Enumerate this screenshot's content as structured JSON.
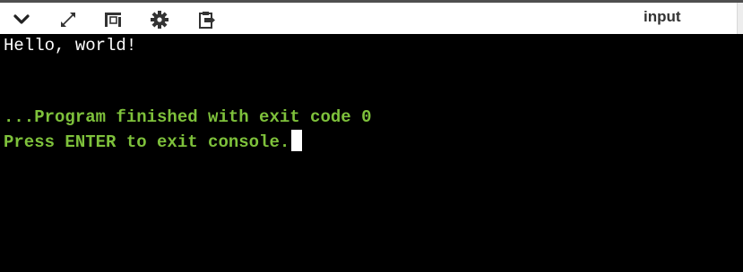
{
  "toolbar": {
    "icons": {
      "collapse": "chevron-down-icon",
      "expand": "expand-arrows-icon",
      "layout": "layout-panel-icon",
      "settings": "gear-icon",
      "share": "clipboard-share-icon"
    },
    "input_tab_label": "input"
  },
  "console": {
    "output_line": "Hello, world!",
    "finished_line": "...Program finished with exit code 0",
    "press_line": "Press ENTER to exit console."
  },
  "colors": {
    "toolbar_bg": "#ffffff",
    "console_bg": "#000000",
    "output_text": "#ffffff",
    "status_text": "#7ec13b",
    "left_edge": "#2a5ea8"
  }
}
